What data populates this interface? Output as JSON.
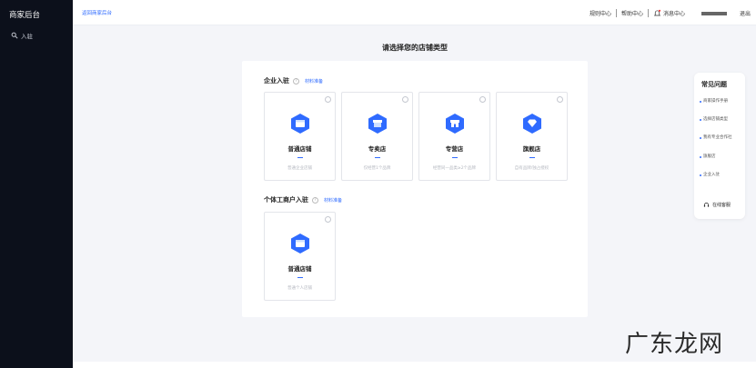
{
  "sidebar": {
    "title": "商家后台",
    "nav_item": "入驻"
  },
  "topbar": {
    "back_link": "返回商家后台",
    "links": [
      "规则中心",
      "帮助中心"
    ],
    "messages": "消息中心",
    "logout": "退出"
  },
  "heading": "请选择您的店铺类型",
  "enterprise": {
    "title": "企业入驻",
    "link": "材料准备",
    "cards": [
      {
        "name": "普通店铺",
        "desc": "普通企业店铺"
      },
      {
        "name": "专卖店",
        "desc": "仅经营1个品牌"
      },
      {
        "name": "专营店",
        "desc": "经营同一品类≥2个品牌"
      },
      {
        "name": "旗舰店",
        "desc": "自有品牌/独占授权"
      }
    ]
  },
  "individual": {
    "title": "个体工商户入驻",
    "link": "材料准备",
    "cards": [
      {
        "name": "普通店铺",
        "desc": "普通个人店铺"
      }
    ]
  },
  "faq": {
    "title": "常见问题",
    "items": [
      "商家操作手册",
      "选择店铺类型",
      "我有专业合作社",
      "旗舰店",
      "企业入驻"
    ],
    "service": "在线客服"
  },
  "watermark": "广东龙网",
  "colors": {
    "accent": "#2f6bff",
    "sidebar": "#0c101b"
  }
}
